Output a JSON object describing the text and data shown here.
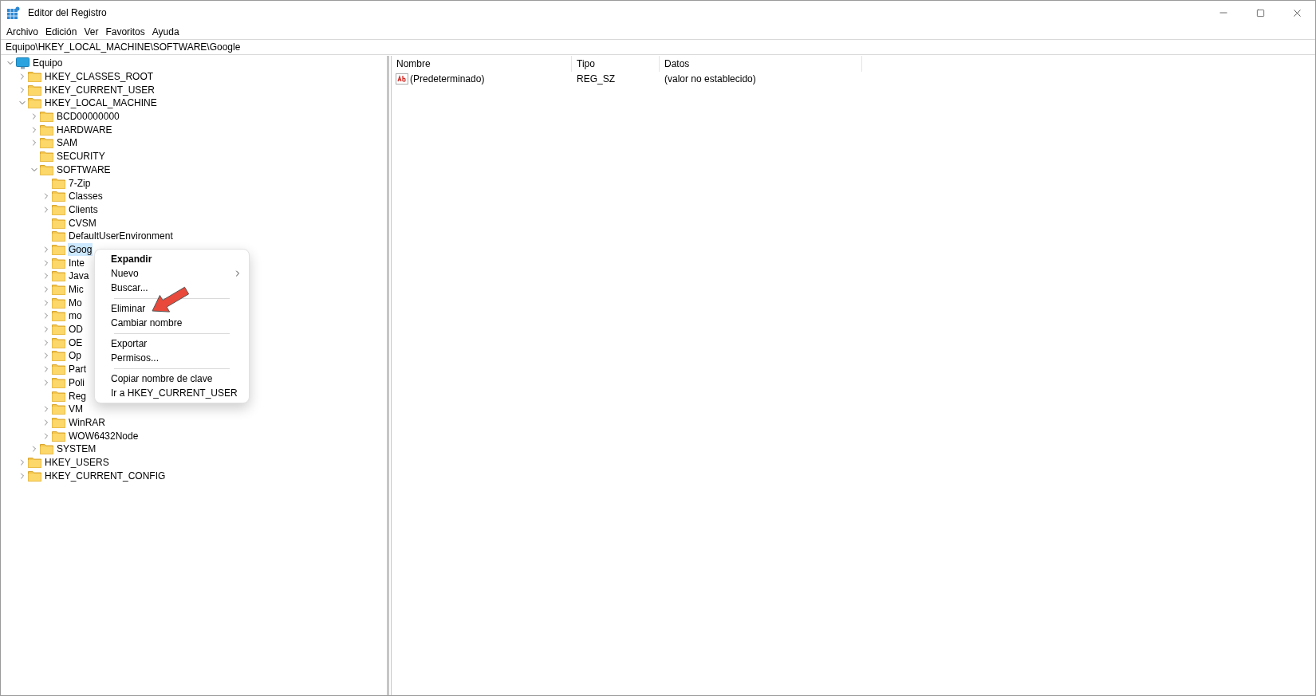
{
  "window": {
    "title": "Editor del Registro"
  },
  "menu_bar": [
    "Archivo",
    "Edición",
    "Ver",
    "Favoritos",
    "Ayuda"
  ],
  "address_bar": "Equipo\\HKEY_LOCAL_MACHINE\\SOFTWARE\\Google",
  "tree": [
    {
      "label": "Equipo",
      "kind": "computer",
      "expanded": true,
      "selected": false,
      "children": [
        {
          "label": "HKEY_CLASSES_ROOT",
          "expanded": false,
          "selected": false
        },
        {
          "label": "HKEY_CURRENT_USER",
          "expanded": false,
          "selected": false
        },
        {
          "label": "HKEY_LOCAL_MACHINE",
          "expanded": true,
          "selected": false,
          "children": [
            {
              "label": "BCD00000000",
              "expanded": false,
              "selected": false
            },
            {
              "label": "HARDWARE",
              "expanded": false,
              "selected": false
            },
            {
              "label": "SAM",
              "expanded": false,
              "selected": false
            },
            {
              "label": "SECURITY",
              "selected": false
            },
            {
              "label": "SOFTWARE",
              "expanded": true,
              "selected": false,
              "children": [
                {
                  "label": "7-Zip",
                  "selected": false
                },
                {
                  "label": "Classes",
                  "expanded": false,
                  "selected": false
                },
                {
                  "label": "Clients",
                  "expanded": false,
                  "selected": false
                },
                {
                  "label": "CVSM",
                  "selected": false
                },
                {
                  "label": "DefaultUserEnvironment",
                  "selected": false
                },
                {
                  "label": "Goog",
                  "expanded": false,
                  "selected": true
                },
                {
                  "label": "Inte",
                  "expanded": false,
                  "selected": false
                },
                {
                  "label": "Java",
                  "expanded": false,
                  "selected": false
                },
                {
                  "label": "Mic",
                  "expanded": false,
                  "selected": false
                },
                {
                  "label": "Mo",
                  "expanded": false,
                  "selected": false
                },
                {
                  "label": "mo",
                  "expanded": false,
                  "selected": false
                },
                {
                  "label": "OD",
                  "expanded": false,
                  "selected": false
                },
                {
                  "label": "OE",
                  "expanded": false,
                  "selected": false
                },
                {
                  "label": "Op",
                  "expanded": false,
                  "selected": false
                },
                {
                  "label": "Part",
                  "expanded": false,
                  "selected": false
                },
                {
                  "label": "Poli",
                  "expanded": false,
                  "selected": false
                },
                {
                  "label": "Reg",
                  "selected": false
                },
                {
                  "label": "VM",
                  "expanded": false,
                  "selected": false
                },
                {
                  "label": "WinRAR",
                  "expanded": false,
                  "selected": false
                },
                {
                  "label": "WOW6432Node",
                  "expanded": false,
                  "selected": false
                }
              ]
            },
            {
              "label": "SYSTEM",
              "expanded": false,
              "selected": false
            }
          ]
        },
        {
          "label": "HKEY_USERS",
          "expanded": false,
          "selected": false
        },
        {
          "label": "HKEY_CURRENT_CONFIG",
          "expanded": false,
          "selected": false
        }
      ]
    }
  ],
  "table": {
    "columns": [
      "Nombre",
      "Tipo",
      "Datos"
    ],
    "rows": [
      {
        "name": "(Predeterminado)",
        "type": "REG_SZ",
        "data": "(valor no establecido)"
      }
    ]
  },
  "context_menu": {
    "groups": [
      [
        {
          "label": "Expandir",
          "default": true,
          "submenu": false
        },
        {
          "label": "Nuevo",
          "default": false,
          "submenu": true
        },
        {
          "label": "Buscar...",
          "default": false,
          "submenu": false
        }
      ],
      [
        {
          "label": "Eliminar",
          "default": false,
          "submenu": false
        },
        {
          "label": "Cambiar nombre",
          "default": false,
          "submenu": false
        }
      ],
      [
        {
          "label": "Exportar",
          "default": false,
          "submenu": false
        },
        {
          "label": "Permisos...",
          "default": false,
          "submenu": false
        }
      ],
      [
        {
          "label": "Copiar nombre de clave",
          "default": false,
          "submenu": false
        },
        {
          "label": "Ir a HKEY_CURRENT_USER",
          "default": false,
          "submenu": false
        }
      ]
    ]
  }
}
